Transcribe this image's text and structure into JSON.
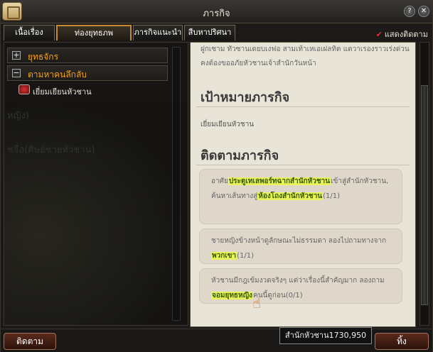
{
  "window": {
    "title": "ภารกิจ"
  },
  "tabs": [
    {
      "label": "เนื้อเรื่อง"
    },
    {
      "label": "ท่องยุทธภพ"
    },
    {
      "label": "ภารกิจแนะนำ"
    },
    {
      "label": "สืบหาปริศนา"
    }
  ],
  "show_tracking": "แสดงติดตาม",
  "tree": {
    "categories": [
      {
        "label": "ยุทธจักร",
        "toggle": "+"
      },
      {
        "label": "ตามหาคนลึกลับ",
        "toggle": "−"
      }
    ],
    "quest": "เยี่ยมเยียนหัวชาน"
  },
  "background_text": [
    "หญิง)",
    "ชจื่อ(ศิษย์ชายหัวชาน)"
  ],
  "detail": {
    "intro": "ฝูกเซาม ทัวซานเดยบเงฟอ สามเท้าเหเอเฝลทิต แตวาเรองราวเร่งด่วน คงต้องขออภัยหัวชานเจ้าสำนักวันหน้า",
    "goal_title": "เป้าหมายภารกิจ",
    "goal_text": "เยี่ยมเยียนหัวชาน",
    "track_title": "ติดตามภารกิจ",
    "steps": [
      {
        "p1": "อาศัย",
        "h1": "ประตูเทเลพอร์ทฉากสำนักหัวชาน",
        "p2": "เข้าสู่สำนักหัวชาน, ค้นหาเส้นทางสู่",
        "h2": "ห้องโถงสำนักหัวชาน",
        "p3": "(1/1)"
      },
      {
        "p1": "ชายหญิงข้างหน้าดูลักษณะไม่ธรรมดา ลองไปถามทางจาก",
        "h1": "พวกเขา",
        "p2": "(1/1)"
      },
      {
        "p1": "หัวชานมีกฎเข้มงวดจริงๆ แต่ว่าเรื่องนี้สำคัญมาก ลองถาม",
        "h1": "จอมยุทธหญิง",
        "p2": "คนนี้ดูก่อน(0/1)"
      }
    ]
  },
  "location_tip": "สำนักหัวชาน1730,950",
  "buttons": {
    "track": "ติดตาม",
    "abandon": "ทิ้ง"
  },
  "colors": {
    "accent": "#f0a21c",
    "highlight": "#e8f45a",
    "parchment": "#e9e4d8"
  }
}
